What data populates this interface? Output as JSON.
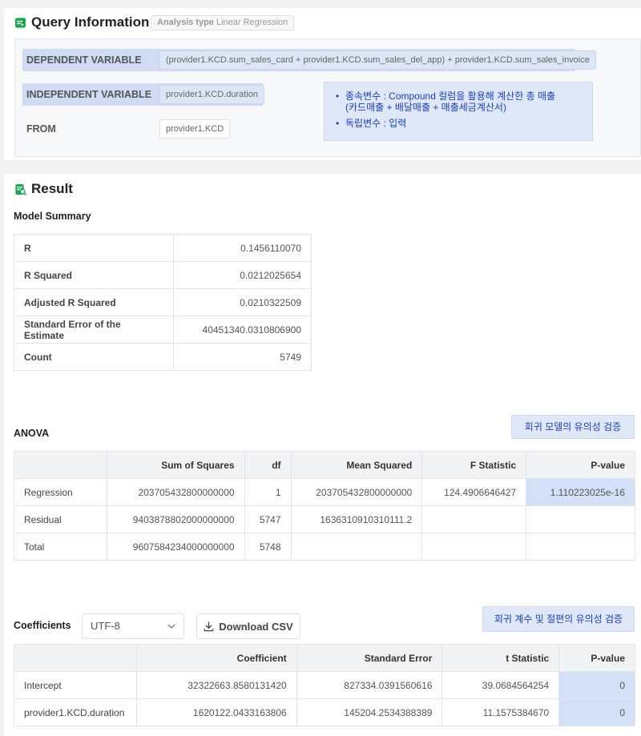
{
  "query": {
    "title": "Query Information",
    "analysis_type_key": "Analysis type",
    "analysis_type_value": "Linear Regression",
    "dependent_label": "DEPENDENT VARIABLE",
    "dependent_value": "(provider1.KCD.sum_sales_card + provider1.KCD.sum_sales_del_app) + provider1.KCD.sum_sales_invoice",
    "independent_label": "INDEPENDENT VARIABLE",
    "independent_value": "provider1.KCD.duration",
    "from_label": "FROM",
    "from_value": "provider1.KCD",
    "note_line1a": "종속변수 : Compound 컬럼을 활용해 계산한 총 매출",
    "note_line1b": "(카드매출 + 배달매출 + 매출세금계산서)",
    "note_line2": "독립변수 : 입력"
  },
  "result": {
    "title": "Result",
    "model_summary": {
      "title": "Model Summary",
      "rows": [
        {
          "label": "R",
          "value": "0.1456110070"
        },
        {
          "label": "R Squared",
          "value": "0.0212025654"
        },
        {
          "label": "Adjusted R Squared",
          "value": "0.0210322509"
        },
        {
          "label": "Standard Error of the Estimate",
          "value": "40451340.0310806900"
        },
        {
          "label": "Count",
          "value": "5749"
        }
      ]
    },
    "anova": {
      "title": "ANOVA",
      "callout": "회귀 모델의 유의성 검증",
      "headers": [
        "",
        "Sum of Squares",
        "df",
        "Mean Squared",
        "F Statistic",
        "P-value"
      ],
      "rows": [
        [
          "Regression",
          "203705432800000000",
          "1",
          "203705432800000000",
          "124.4906646427",
          "1.110223025e-16"
        ],
        [
          "Residual",
          "9403878802000000000",
          "5747",
          "1636310910310111.2",
          "",
          ""
        ],
        [
          "Total",
          "9607584234000000000",
          "5748",
          "",
          "",
          ""
        ]
      ]
    },
    "coefficients": {
      "title": "Coefficients",
      "encoding": "UTF-8",
      "download_label": "Download CSV",
      "callout": "회귀 계수 및 절편의 유의성 검증",
      "headers": [
        "",
        "Coefficient",
        "Standard Error",
        "t Statistic",
        "P-value"
      ],
      "rows": [
        [
          "Intercept",
          "32322663.8580131420",
          "827334.0391560616",
          "39.0684564254",
          "0"
        ],
        [
          "provider1.KCD.duration",
          "1620122.0433163806",
          "145204.2534388389",
          "11.1575384670",
          "0"
        ]
      ]
    }
  },
  "colors": {
    "accent_green": "#1aa84c",
    "highlight_blue": "#cfdcf4",
    "note_text": "#1c3dbf"
  },
  "icons": {
    "query": "query-icon",
    "result": "result-icon",
    "dropdown": "chevron-down-icon",
    "download": "download-icon"
  }
}
